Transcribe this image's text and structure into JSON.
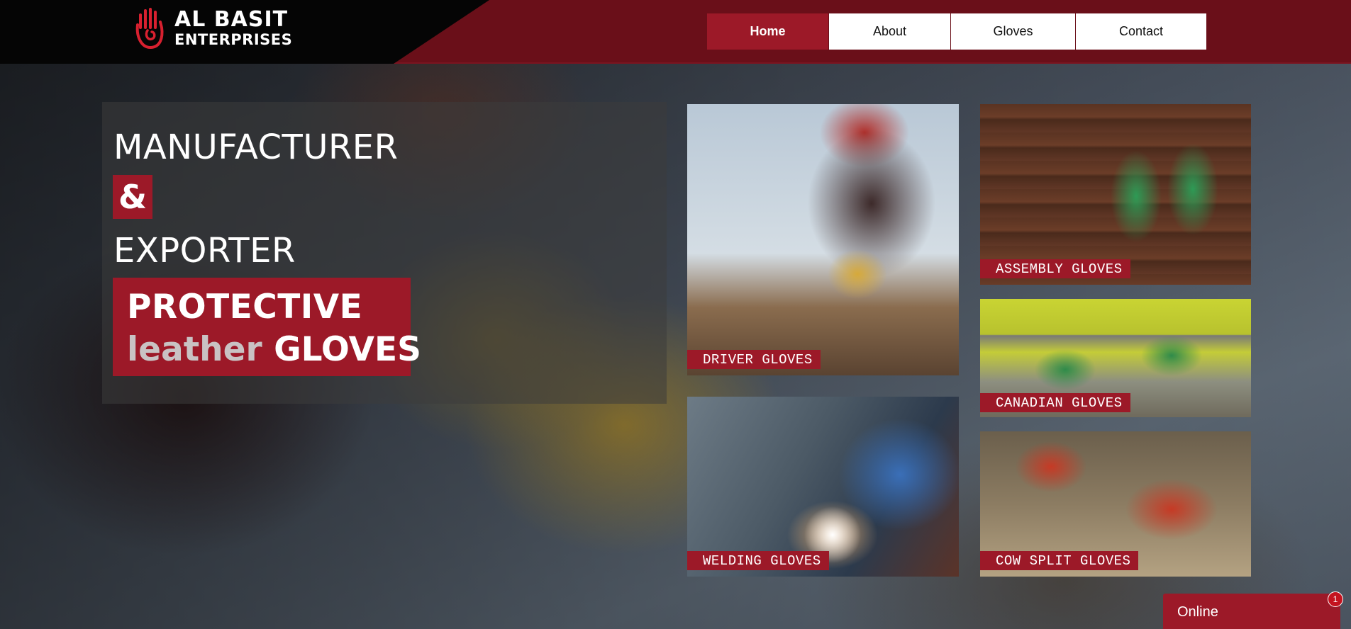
{
  "brand": {
    "line1": "AL BASIT",
    "line2": "ENTERPRISES",
    "logo_icon": "hand-glove-logo-icon",
    "accent_color": "#9c1928",
    "header_color": "#6a0f19"
  },
  "nav": {
    "items": [
      {
        "label": "Home",
        "active": true
      },
      {
        "label": "About",
        "active": false
      },
      {
        "label": "Gloves",
        "active": false
      },
      {
        "label": "Contact",
        "active": false
      }
    ]
  },
  "hero": {
    "line1": "MANUFACTURER",
    "line2": "&",
    "line3": "EXPORTER",
    "tag_line1": "PROTECTIVE",
    "tag_leather": "leather",
    "tag_gloves": "GLOVES"
  },
  "products": [
    {
      "label": "DRIVER GLOVES"
    },
    {
      "label": "ASSEMBLY GLOVES"
    },
    {
      "label": "CANADIAN GLOVES"
    },
    {
      "label": "WELDING GLOVES"
    },
    {
      "label": "COW SPLIT GLOVES"
    }
  ],
  "chat": {
    "label": "Online",
    "badge": "1"
  }
}
